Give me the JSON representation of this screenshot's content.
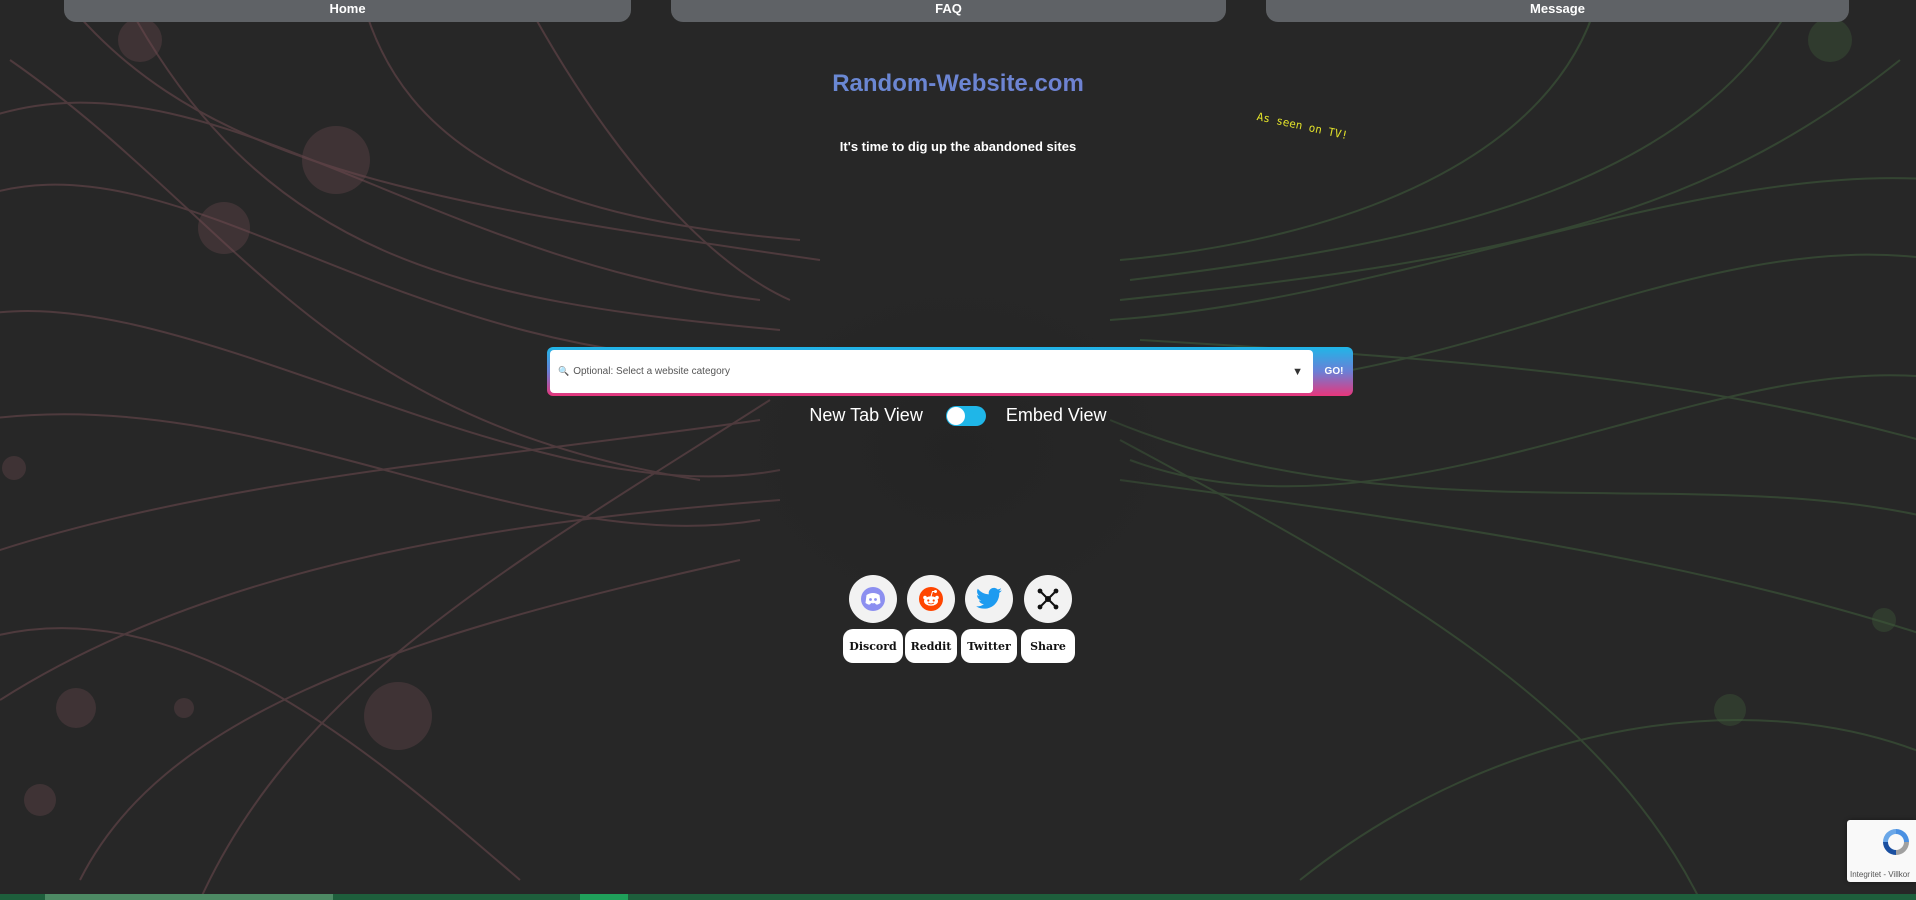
{
  "nav": {
    "items": [
      {
        "label": "Home"
      },
      {
        "label": "FAQ"
      },
      {
        "label": "Message"
      }
    ]
  },
  "header": {
    "title": "Random-Website.com",
    "tagline": "It's time to dig up the abandoned sites",
    "badge": "As seen on TV!"
  },
  "search": {
    "placeholder": "Optional: Select a website category",
    "icon": "search-icon",
    "dropdown_icon": "chevron-down-icon",
    "go_label": "GO!"
  },
  "view_toggle": {
    "left_label": "New Tab View",
    "right_label": "Embed View"
  },
  "social": [
    {
      "label": "Discord",
      "icon": "discord-icon"
    },
    {
      "label": "Reddit",
      "icon": "reddit-icon"
    },
    {
      "label": "Twitter",
      "icon": "twitter-icon"
    },
    {
      "label": "Share",
      "icon": "share-icon"
    }
  ],
  "recaptcha": {
    "text": "Integritet - Villkor"
  },
  "colors": {
    "background": "#272727",
    "nav_button": "#5f6266",
    "title_gradient_start": "#5b9bd5",
    "title_gradient_end": "#7d6fd0",
    "badge_text": "#e2e22a",
    "toggle_on": "#1fb6e8",
    "search_gradient_top": "#1fb6e8",
    "search_gradient_bottom": "#e8357b",
    "discord": "#8c8ff0",
    "reddit": "#ff4500",
    "twitter": "#1d9bf0"
  }
}
